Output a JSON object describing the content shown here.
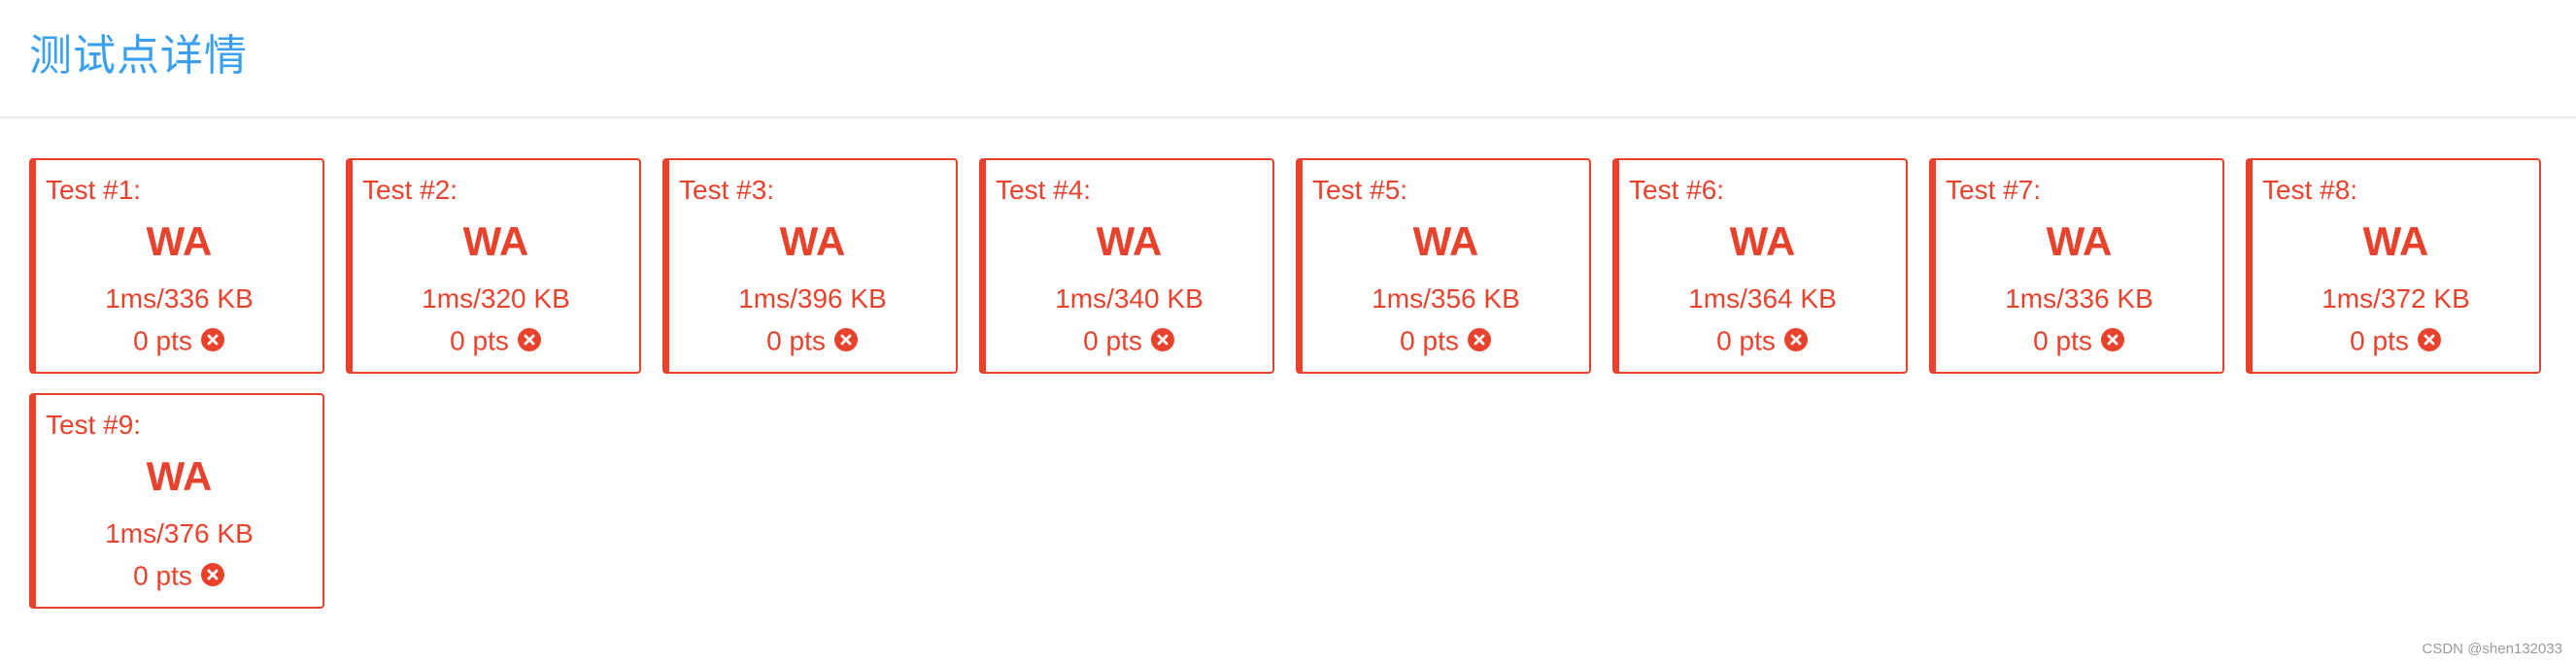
{
  "header": {
    "title": "测试点详情"
  },
  "colors": {
    "accent": "#3a9ff0",
    "wrong_answer": "#e8412c",
    "divider": "#e8e8e8"
  },
  "tests": [
    {
      "label": "Test #1:",
      "status": "WA",
      "usage": "1ms/336 KB",
      "points": "0 pts",
      "icon": "x-circle-icon"
    },
    {
      "label": "Test #2:",
      "status": "WA",
      "usage": "1ms/320 KB",
      "points": "0 pts",
      "icon": "x-circle-icon"
    },
    {
      "label": "Test #3:",
      "status": "WA",
      "usage": "1ms/396 KB",
      "points": "0 pts",
      "icon": "x-circle-icon"
    },
    {
      "label": "Test #4:",
      "status": "WA",
      "usage": "1ms/340 KB",
      "points": "0 pts",
      "icon": "x-circle-icon"
    },
    {
      "label": "Test #5:",
      "status": "WA",
      "usage": "1ms/356 KB",
      "points": "0 pts",
      "icon": "x-circle-icon"
    },
    {
      "label": "Test #6:",
      "status": "WA",
      "usage": "1ms/364 KB",
      "points": "0 pts",
      "icon": "x-circle-icon"
    },
    {
      "label": "Test #7:",
      "status": "WA",
      "usage": "1ms/336 KB",
      "points": "0 pts",
      "icon": "x-circle-icon"
    },
    {
      "label": "Test #8:",
      "status": "WA",
      "usage": "1ms/372 KB",
      "points": "0 pts",
      "icon": "x-circle-icon"
    },
    {
      "label": "Test #9:",
      "status": "WA",
      "usage": "1ms/376 KB",
      "points": "0 pts",
      "icon": "x-circle-icon"
    }
  ],
  "watermark": "CSDN @shen132033"
}
